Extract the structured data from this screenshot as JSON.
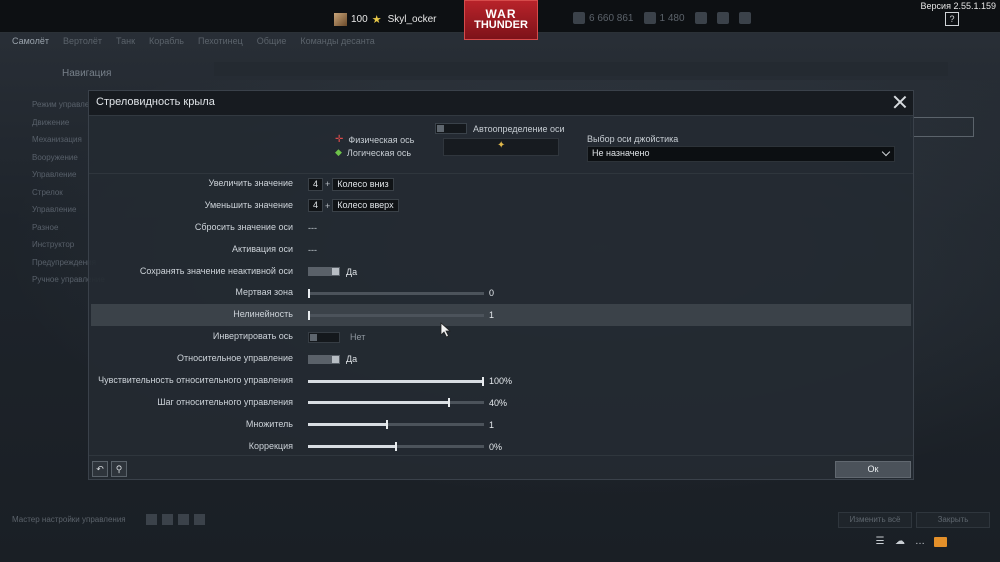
{
  "app": {
    "version": "Версия 2.55.1.159",
    "help_label": "?",
    "logo_line1": "WAR",
    "logo_line2": "THUNDER"
  },
  "player": {
    "level": "100",
    "name": "Skyl_ocker"
  },
  "top_stats": {
    "silver": "6 660 861",
    "gold": "1 480"
  },
  "background": {
    "tabs": [
      "Самолёт",
      "Вертолёт",
      "Танк",
      "Корабль",
      "Пехотинец",
      "Общие",
      "Команды десанта"
    ],
    "nav_title": "Навигация",
    "side_items": [
      "Режим управления",
      "Движение",
      "Механизация",
      "Вооружение",
      "Управление",
      "Стрелок",
      "Управление",
      "Разное",
      "Инструктор",
      "Предупреждения",
      "Ручное управление"
    ],
    "bottom_left": "Мастер настройки управления",
    "bottom_right_1": "Изменить всё",
    "bottom_right_2": "Закрыть"
  },
  "modal": {
    "title": "Стреловидность крыла",
    "legend_physical": "Физическая ось",
    "legend_logical": "Логическая ось",
    "auto_detect_label": "Автоопределение оси",
    "joystick_axis_label": "Выбор оси джойстика",
    "joystick_axis_value": "Не назначено",
    "ok_label": "Ок",
    "rows": [
      {
        "label": "Увеличить значение",
        "kind": "keys",
        "key1": "4",
        "key2": "Колесо вниз"
      },
      {
        "label": "Уменьшить значение",
        "kind": "keys",
        "key1": "4",
        "key2": "Колесо вверх"
      },
      {
        "label": "Сбросить значение оси",
        "kind": "dash",
        "value": "---"
      },
      {
        "label": "Активация оси",
        "kind": "dash",
        "value": "---"
      },
      {
        "label": "Сохранять значение неактивной оси",
        "kind": "toggle",
        "on": true,
        "value": "Да"
      },
      {
        "label": "Мертвая зона",
        "kind": "slider",
        "fraction": 0.0,
        "value": "0"
      },
      {
        "label": "Нелинейность",
        "kind": "slider",
        "fraction": 0.0,
        "value": "1",
        "selected": true
      },
      {
        "label": "Инвертировать ось",
        "kind": "toggle",
        "on": false,
        "value": "Нет"
      },
      {
        "label": "Относительное управление",
        "kind": "toggle",
        "on": true,
        "value": "Да"
      },
      {
        "label": "Чувствительность относительного управления",
        "kind": "slider",
        "fraction": 1.0,
        "value": "100%"
      },
      {
        "label": "Шаг относительного управления",
        "kind": "slider",
        "fraction": 0.8,
        "value": "40%"
      },
      {
        "label": "Множитель",
        "kind": "slider",
        "fraction": 0.45,
        "value": "1"
      },
      {
        "label": "Коррекция",
        "kind": "slider",
        "fraction": 0.5,
        "value": "0%"
      }
    ]
  },
  "icons": {
    "close": "close-icon",
    "reset": "reset-icon",
    "joystick": "joystick-icon",
    "star": "star-icon",
    "mail": "mail-icon"
  },
  "colors": {
    "physical_axis": "#d84a4a",
    "logical_axis": "#6ec24a",
    "axis_dot": "#e0b84a",
    "logo_red": "#b8232a",
    "mail_orange": "#e4902a"
  }
}
